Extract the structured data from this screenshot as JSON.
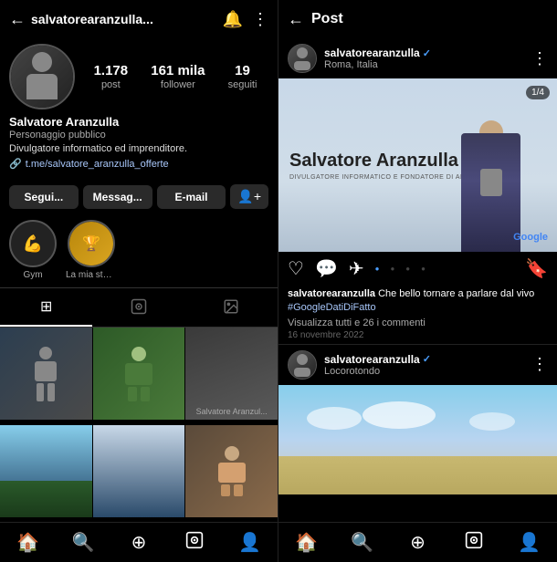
{
  "left": {
    "topbar": {
      "back_label": "←",
      "username": "salvatorearanzulla...",
      "bell_label": "🔔",
      "more_label": "⋮"
    },
    "profile": {
      "name": "Salvatore Aranzulla",
      "category": "Personaggio pubblico",
      "bio": "Divulgatore informatico ed imprenditore.",
      "link": "t.me/salvatore_aranzulla_offerte",
      "stats": [
        {
          "number": "1.178",
          "label": "post"
        },
        {
          "number": "161 mila",
          "label": "follower"
        },
        {
          "number": "19",
          "label": "seguiti"
        }
      ]
    },
    "buttons": [
      {
        "label": "Segui...",
        "id": "follow"
      },
      {
        "label": "Messag...",
        "id": "message"
      },
      {
        "label": "E-mail",
        "id": "email"
      }
    ],
    "add_button_label": "👤+",
    "stories": [
      {
        "label": "Gym",
        "id": "gym"
      },
      {
        "label": "La mia storia",
        "id": "mystory"
      }
    ],
    "tabs": [
      {
        "icon": "⊞",
        "active": true,
        "id": "grid"
      },
      {
        "icon": "🎬",
        "active": false,
        "id": "reels"
      },
      {
        "icon": "📷",
        "active": false,
        "id": "tagged"
      }
    ],
    "grid": [
      {
        "id": "gc-1",
        "class": "gc-1"
      },
      {
        "id": "gc-2",
        "class": "gc-2"
      },
      {
        "id": "gc-3",
        "class": "gc-3"
      },
      {
        "id": "gc-4",
        "class": "gc-4"
      },
      {
        "id": "gc-5",
        "class": "gc-5"
      },
      {
        "id": "gc-6",
        "class": "gc-6"
      }
    ],
    "bottom_nav": [
      {
        "icon": "🏠",
        "label": "home",
        "active": true
      },
      {
        "icon": "🔍",
        "label": "search"
      },
      {
        "icon": "⊕",
        "label": "add"
      },
      {
        "icon": "🎬",
        "label": "reels"
      },
      {
        "icon": "👤",
        "label": "profile"
      }
    ]
  },
  "right": {
    "topbar": {
      "back_label": "←",
      "title": "Post"
    },
    "post": {
      "username": "salvatorearanzulla",
      "verified": true,
      "location": "Roma, Italia",
      "counter": "1/4",
      "overlay_title": "Salvatore Aranzulla",
      "overlay_subtitle": "DIVULGATORE INFORMATICO E FONDATORE DI ARA...",
      "google_label": "Google",
      "caption_user": "salvatorearanzulla",
      "caption_text": " Che bello tornare a parlare dal vivo #GoogleDatiDiFatto",
      "hashtag": "#GoogleDatiDiFatto",
      "view_comments": "Visualizza tutti e 26 i commenti",
      "date": "16 novembre 2022"
    },
    "second_post": {
      "username": "salvatorearanzulla",
      "verified": true,
      "location": "Locorotondo"
    },
    "bottom_nav": [
      {
        "icon": "🏠",
        "label": "home"
      },
      {
        "icon": "🔍",
        "label": "search"
      },
      {
        "icon": "⊕",
        "label": "add"
      },
      {
        "icon": "🎬",
        "label": "reels"
      },
      {
        "icon": "👤",
        "label": "profile"
      }
    ]
  }
}
